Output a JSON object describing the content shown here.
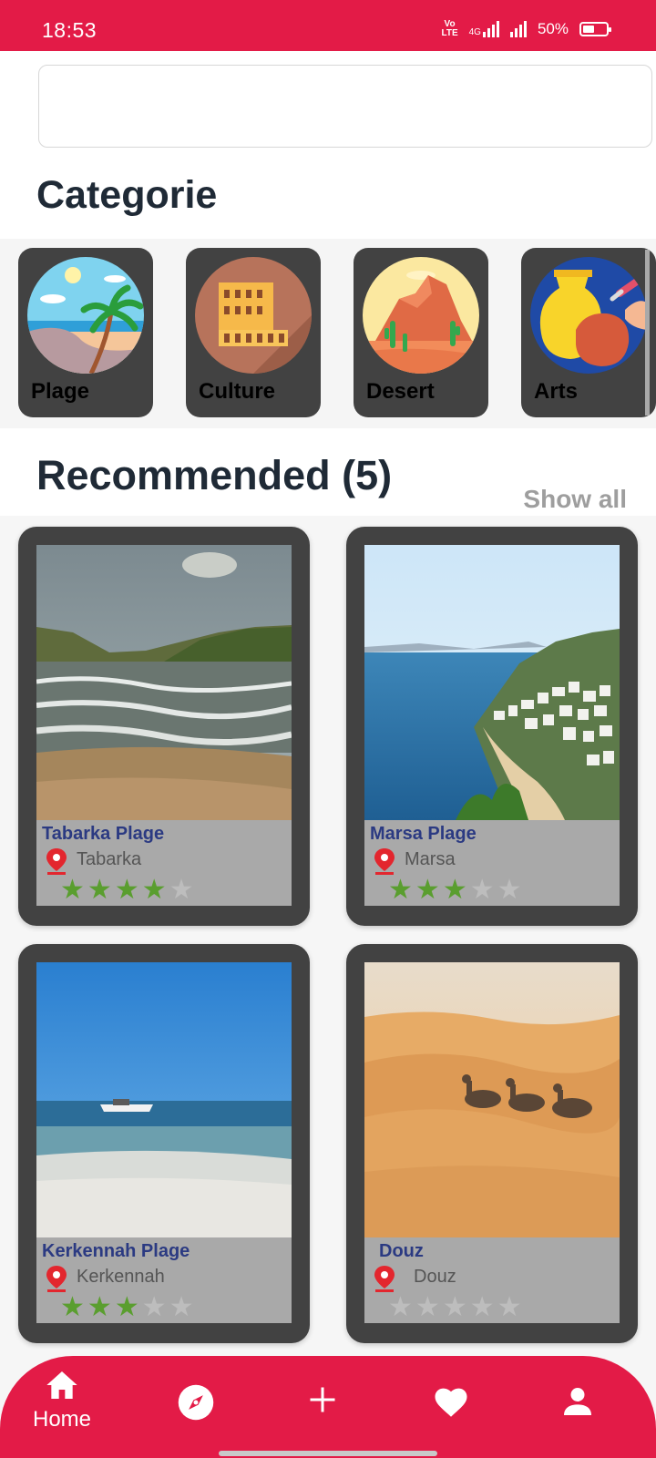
{
  "status": {
    "time": "18:53",
    "network": "4G",
    "battery": "50%"
  },
  "search": {
    "placeholder": ""
  },
  "categories_title": "Categorie",
  "categories": [
    {
      "label": "Plage",
      "icon": "beach-icon"
    },
    {
      "label": "Culture",
      "icon": "colosseum-icon"
    },
    {
      "label": "Desert",
      "icon": "desert-icon"
    },
    {
      "label": "Arts",
      "icon": "pottery-icon"
    }
  ],
  "recommended_title": "Recommended (5)",
  "show_all": "Show all",
  "places": [
    {
      "name": "Tabarka Plage",
      "location": "Tabarka",
      "rating": 4,
      "max_rating": 5,
      "image": "beach-waves-photo"
    },
    {
      "name": "Marsa Plage",
      "location": "Marsa",
      "rating": 3,
      "max_rating": 5,
      "image": "coastal-town-photo"
    },
    {
      "name": "Kerkennah Plage",
      "location": "Kerkennah",
      "rating": 3,
      "max_rating": 5,
      "image": "shallow-sea-boat-photo"
    },
    {
      "name": "Douz",
      "location": "Douz",
      "rating": 0,
      "max_rating": 5,
      "image": "desert-camels-photo"
    }
  ],
  "nav": {
    "home_label": "Home"
  },
  "colors": {
    "primary": "#e31b47",
    "card": "#424242",
    "title": "#1f2a36",
    "place_name": "#2b3a82",
    "star_on": "#5a9e2f"
  }
}
